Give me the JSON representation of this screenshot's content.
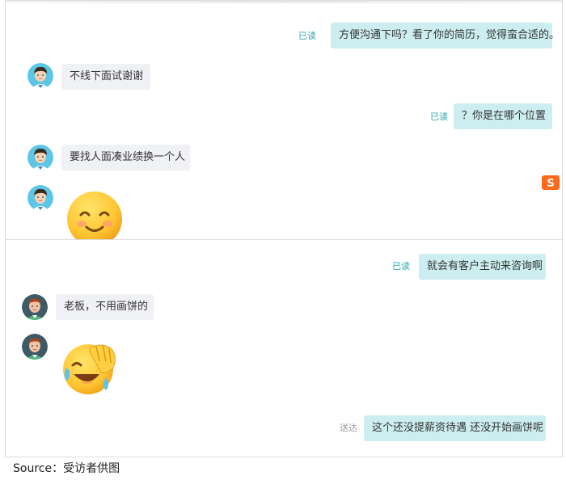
{
  "panel1": {
    "messages": [
      {
        "side": "out",
        "text": "方便沟通下吗？看了你的简历，觉得蛮合适的。",
        "status": "已读"
      },
      {
        "side": "in",
        "text": "不线下面试谢谢"
      },
      {
        "side": "out",
        "text": "？你是在哪个位置",
        "status": "已读"
      },
      {
        "side": "in",
        "text": "要找人面凑业绩换一个人"
      },
      {
        "side": "in",
        "emoji": "smiling-face-emoji"
      }
    ],
    "badge_icon": "sogou-s-icon"
  },
  "panel2": {
    "messages": [
      {
        "side": "out",
        "text": "就会有客户主动来咨询啊",
        "status": "已读"
      },
      {
        "side": "in",
        "text": "老板，不用画饼的"
      },
      {
        "side": "in",
        "emoji": "laughing-crying-face-emoji"
      },
      {
        "side": "out",
        "text": "这个还没提薪资待遇 还没开始画饼呢",
        "status": "送达"
      }
    ]
  },
  "caption": "Source：受访者供图",
  "colors": {
    "outgoing_bubble": "#cdeef0",
    "incoming_bubble": "#f0f1f4",
    "read_status": "#2aa8b0",
    "sent_status": "#999999"
  }
}
